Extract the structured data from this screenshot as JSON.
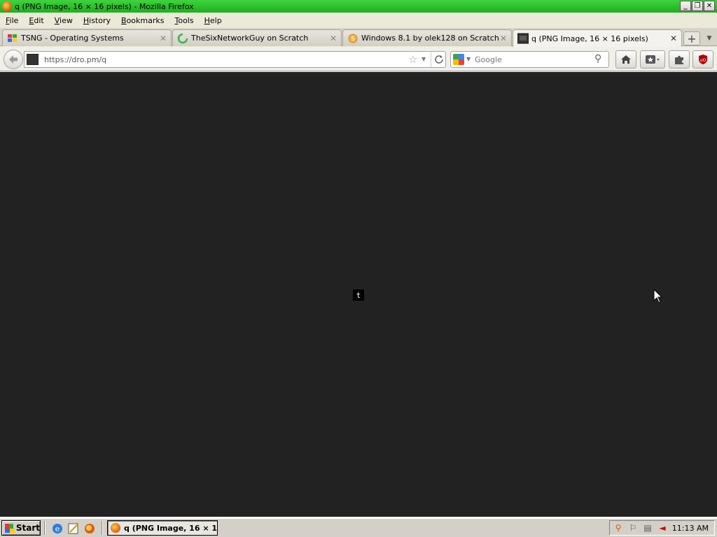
{
  "window": {
    "title": "q (PNG Image, 16 × 16 pixels) - Mozilla Firefox",
    "controls": {
      "minimize": "_",
      "maximize": "❐",
      "close": "✕"
    }
  },
  "menu": {
    "items": [
      {
        "accel": "F",
        "rest": "ile"
      },
      {
        "accel": "E",
        "rest": "dit"
      },
      {
        "accel": "V",
        "rest": "iew"
      },
      {
        "accel": "H",
        "rest": "istory"
      },
      {
        "accel": "B",
        "rest": "ookmarks"
      },
      {
        "accel": "T",
        "rest": "ools"
      },
      {
        "accel": "H",
        "rest": "elp"
      }
    ]
  },
  "tabs": [
    {
      "label": "TSNG - Operating Systems",
      "icon": "windows-icon"
    },
    {
      "label": "TheSixNetworkGuy on Scratch",
      "icon": "loading-spinner-icon"
    },
    {
      "label": "Windows 8.1 by olek128 on Scratch",
      "icon": "scratch-cat-icon"
    },
    {
      "label": "q (PNG Image, 16 × 16 pixels)",
      "icon": "image-thumbnail-icon"
    }
  ],
  "navbar": {
    "url": "https://dro.pm/q",
    "search_placeholder": "Google"
  },
  "content": {
    "image_text": "t",
    "background": "#222222"
  },
  "taskbar": {
    "start_label": "Start",
    "task_label": "q (PNG Image, 16 × 1...",
    "clock": "11:13 AM"
  },
  "colors": {
    "titlebar": "#1fae1f",
    "content_bg": "#222222"
  }
}
